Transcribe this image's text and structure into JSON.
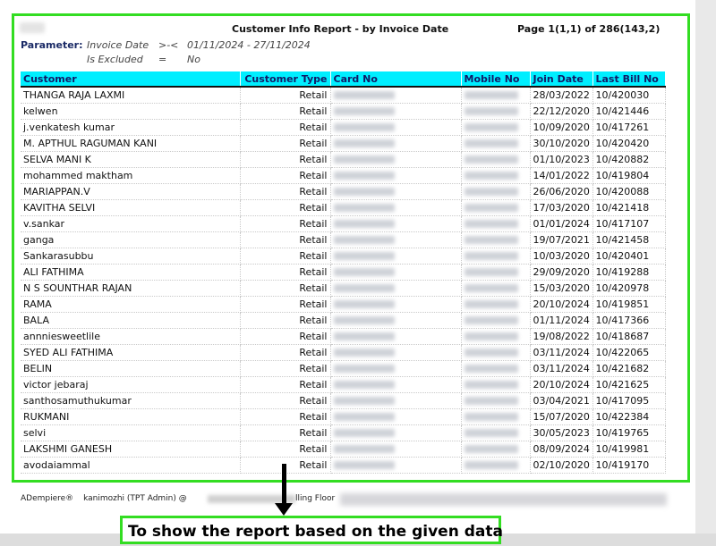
{
  "report": {
    "title": "Customer Info Report - by Invoice Date",
    "page_info": "Page 1(1,1) of 286(143,2)",
    "parameter_label": "Parameter:",
    "parameters": [
      {
        "name": "Invoice Date",
        "op": ">-<",
        "value": "01/11/2024 - 27/11/2024"
      },
      {
        "name": "Is Excluded",
        "op": "=",
        "value": "No"
      }
    ]
  },
  "table": {
    "columns": [
      "Customer",
      "Customer Type",
      "Card No",
      "Mobile No",
      "Join Date",
      "Last Bill No"
    ],
    "rows": [
      {
        "customer": "THANGA RAJA LAXMI",
        "type": "Retail",
        "join": "28/03/2022",
        "bill": "10/420030"
      },
      {
        "customer": "kelwen",
        "type": "Retail",
        "join": "22/12/2020",
        "bill": "10/421446"
      },
      {
        "customer": "j.venkatesh kumar",
        "type": "Retail",
        "join": "10/09/2020",
        "bill": "10/417261"
      },
      {
        "customer": "M. APTHUL RAGUMAN KANI",
        "type": "Retail",
        "join": "30/10/2020",
        "bill": "10/420420"
      },
      {
        "customer": "SELVA MANI K",
        "type": "Retail",
        "join": "01/10/2023",
        "bill": "10/420882"
      },
      {
        "customer": "mohammed maktham",
        "type": "Retail",
        "join": "14/01/2022",
        "bill": "10/419804"
      },
      {
        "customer": "MARIAPPAN.V",
        "type": "Retail",
        "join": "26/06/2020",
        "bill": "10/420088"
      },
      {
        "customer": "KAVITHA SELVI",
        "type": "Retail",
        "join": "17/03/2020",
        "bill": "10/421418"
      },
      {
        "customer": "v.sankar",
        "type": "Retail",
        "join": "01/01/2024",
        "bill": "10/417107"
      },
      {
        "customer": "ganga",
        "type": "Retail",
        "join": "19/07/2021",
        "bill": "10/421458"
      },
      {
        "customer": "Sankarasubbu",
        "type": "Retail",
        "join": "10/03/2020",
        "bill": "10/420401"
      },
      {
        "customer": "ALI FATHIMA",
        "type": "Retail",
        "join": "29/09/2020",
        "bill": "10/419288"
      },
      {
        "customer": "N S SOUNTHAR RAJAN",
        "type": "Retail",
        "join": "15/03/2020",
        "bill": "10/420978"
      },
      {
        "customer": "RAMA",
        "type": "Retail",
        "join": "20/10/2024",
        "bill": "10/419851"
      },
      {
        "customer": "BALA",
        "type": "Retail",
        "join": "01/11/2024",
        "bill": "10/417366"
      },
      {
        "customer": "annniesweetlile",
        "type": "Retail",
        "join": "19/08/2022",
        "bill": "10/418687"
      },
      {
        "customer": "SYED ALI FATHIMA",
        "type": "Retail",
        "join": "03/11/2024",
        "bill": "10/422065"
      },
      {
        "customer": "BELIN",
        "type": "Retail",
        "join": "03/11/2024",
        "bill": "10/421682"
      },
      {
        "customer": "victor jebaraj",
        "type": "Retail",
        "join": "20/10/2024",
        "bill": "10/421625"
      },
      {
        "customer": "santhosamuthukumar",
        "type": "Retail",
        "join": "03/04/2021",
        "bill": "10/417095"
      },
      {
        "customer": "RUKMANI",
        "type": "Retail",
        "join": "15/07/2020",
        "bill": "10/422384"
      },
      {
        "customer": "selvi",
        "type": "Retail",
        "join": "30/05/2023",
        "bill": "10/419765"
      },
      {
        "customer": "LAKSHMI GANESH",
        "type": "Retail",
        "join": "08/09/2024",
        "bill": "10/419981"
      },
      {
        "customer": "avodaiammal",
        "type": "Retail",
        "join": "02/10/2020",
        "bill": "10/419170"
      }
    ]
  },
  "footer": {
    "brand": "ADempiere®",
    "user": "kanimozhi (TPT Admin) @",
    "location_suffix": "lling Floor"
  },
  "caption": "To show the report based on the given data",
  "colors": {
    "highlight_green": "#33dd22",
    "header_cyan": "#00eeff"
  }
}
